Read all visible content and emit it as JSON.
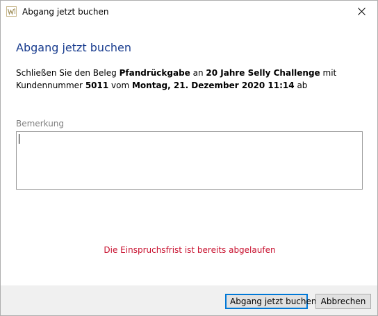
{
  "window": {
    "title": "Abgang jetzt buchen"
  },
  "dialog": {
    "heading": "Abgang jetzt buchen",
    "description": {
      "part1": "Schließen Sie den Beleg ",
      "document_type": "Pfandrückgabe",
      "part2": " an ",
      "customer_name": "20 Jahre Selly Challenge",
      "part3": " mit Kundennummer ",
      "customer_number": "5011",
      "part4": " vom ",
      "date_time": "Montag, 21. Dezember 2020 11:14",
      "part5": " ab"
    },
    "remark": {
      "label": "Bemerkung",
      "value": ""
    },
    "error_message": "Die Einspruchsfrist ist bereits abgelaufen"
  },
  "buttons": {
    "confirm_label": "Abgang jetzt buchen",
    "cancel_label": "Abbrechen"
  },
  "colors": {
    "heading": "#1a3d8f",
    "error": "#c8102e",
    "label": "#808080",
    "focus_border": "#0078d7"
  },
  "icons": {
    "app": "selly-app-icon",
    "close": "close-icon"
  }
}
